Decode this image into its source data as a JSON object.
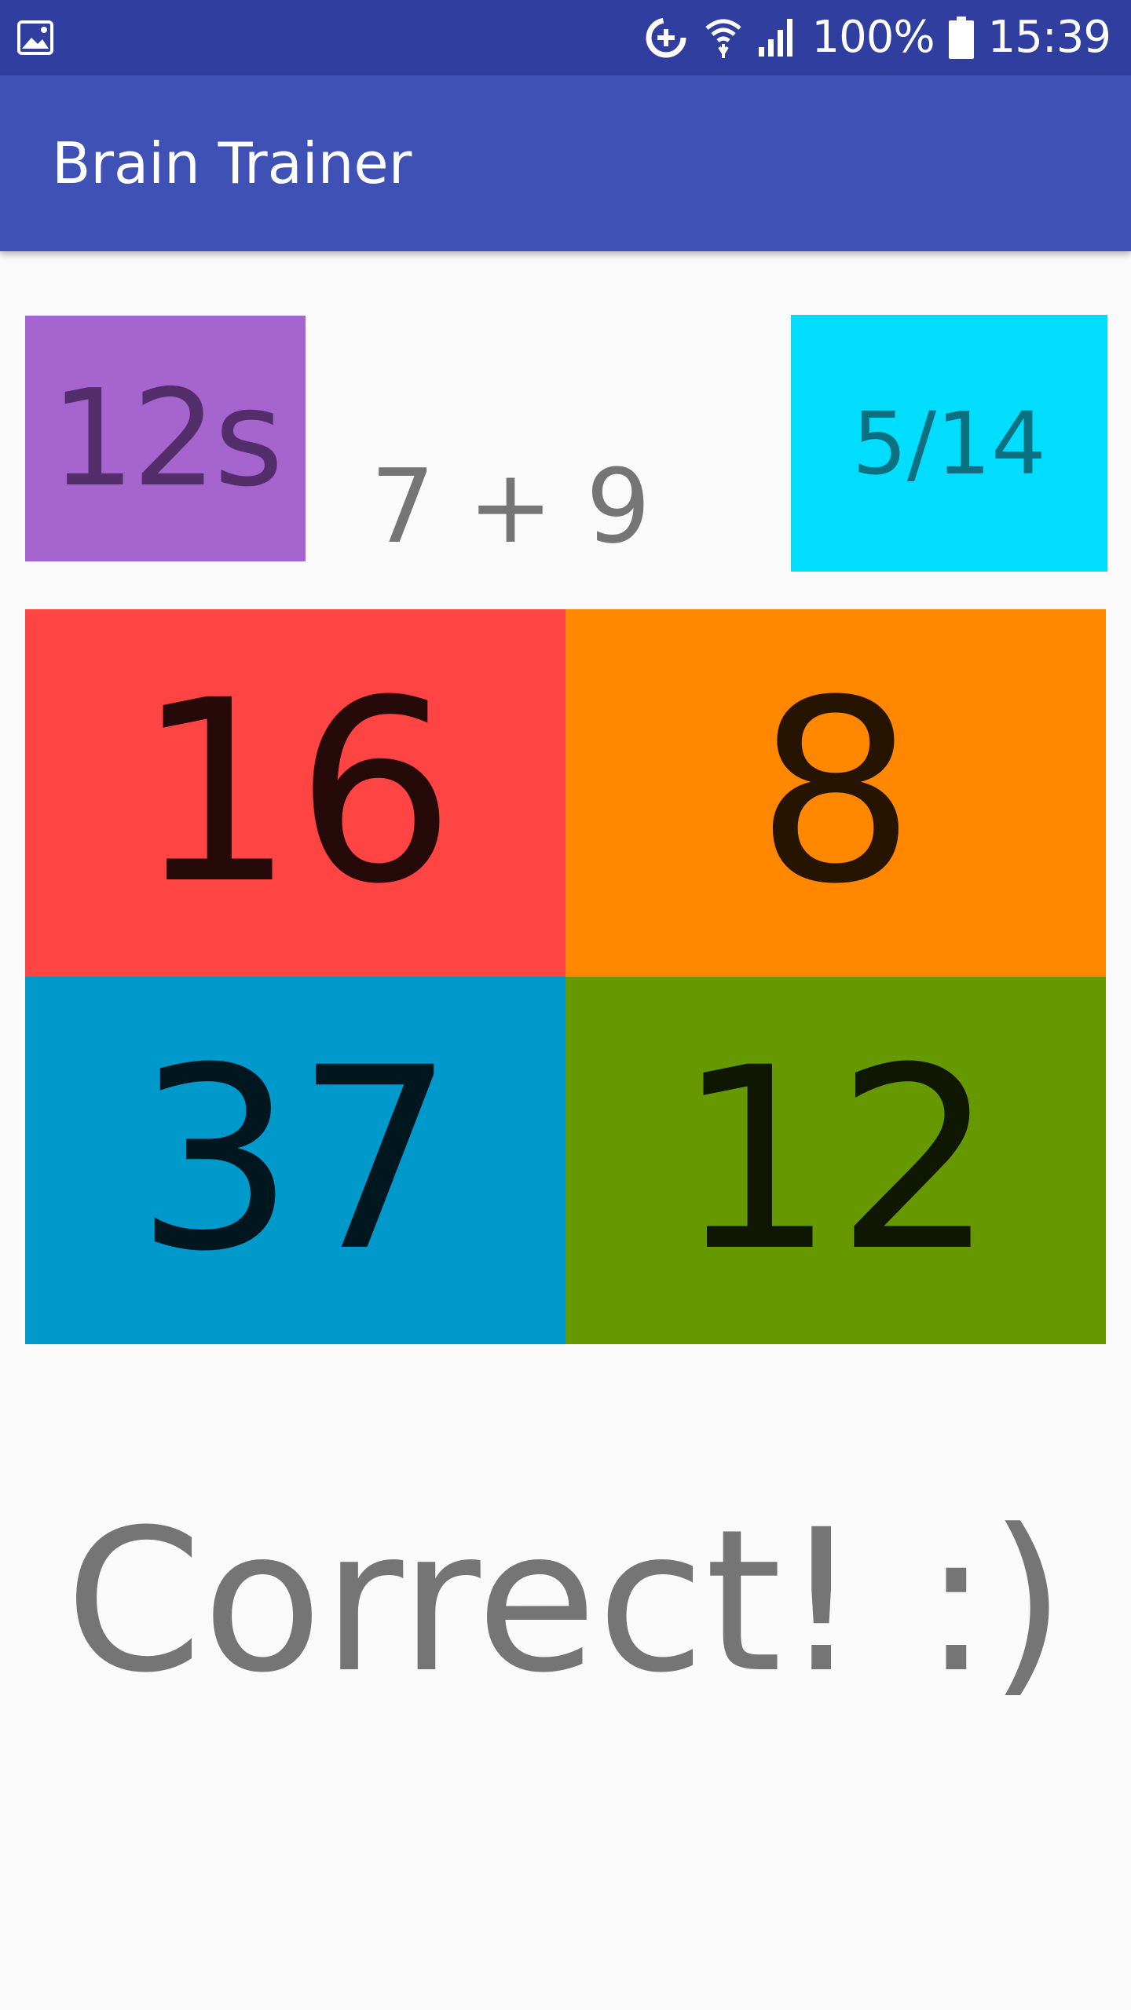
{
  "status_bar": {
    "battery": "100%",
    "time": "15:39",
    "icons": [
      "image-notification-icon",
      "data-saver-icon",
      "wifi-icon",
      "signal-icon",
      "battery-icon"
    ]
  },
  "app_bar": {
    "title": "Brain Trainer"
  },
  "game": {
    "timer": "12s",
    "question": "7 + 9",
    "score": "5/14",
    "answers": [
      {
        "label": "16",
        "color": "#ff4444"
      },
      {
        "label": "8",
        "color": "#ff8800"
      },
      {
        "label": "37",
        "color": "#0099cc"
      },
      {
        "label": "12",
        "color": "#669900"
      }
    ],
    "result": "Correct! :)"
  },
  "colors": {
    "status_bar": "#303f9f",
    "app_bar": "#3f51b5",
    "timer_bg": "#a664cf",
    "score_bg": "#00ddff",
    "background": "#fafafa"
  }
}
